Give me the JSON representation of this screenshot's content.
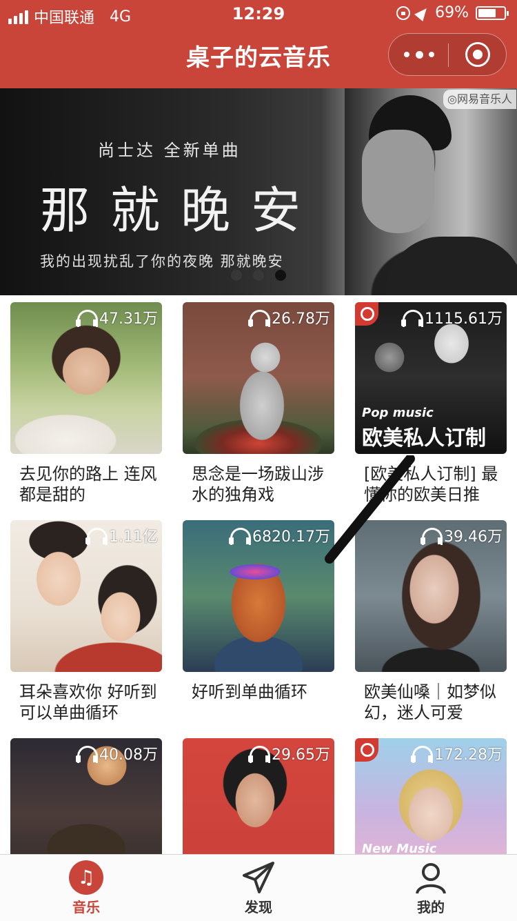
{
  "status_bar": {
    "carrier": "中国联通",
    "network": "4G",
    "time": "12:29",
    "battery": "69%",
    "battery_level": 0.69
  },
  "header": {
    "title": "桌子的云音乐",
    "colors": {
      "brand": "#c9453a"
    }
  },
  "banner": {
    "subtitle": "尚士达 全新单曲",
    "headline": "那就晚安",
    "tagline": "我的出现扰乱了你的夜晚 那就晚安",
    "brand": "网易音乐人",
    "slide_count": 3,
    "active_slide": 3
  },
  "playlists": [
    {
      "play_count": "47.31万",
      "title": "去见你的路上 连风都是甜的",
      "official": false
    },
    {
      "play_count": "26.78万",
      "title": "思念是一场跋山涉水的独角戏",
      "official": false
    },
    {
      "play_count": "1115.61万",
      "title": "[欧美私人订制] 最懂你的欧美日推",
      "official": true,
      "cover_caption_small": "Pop music",
      "cover_caption_big": "欧美私人订制"
    },
    {
      "play_count": "1.11亿",
      "title": "耳朵喜欢你 好听到可以单曲循环",
      "official": false
    },
    {
      "play_count": "6820.17万",
      "title": "好听到单曲循环",
      "official": false
    },
    {
      "play_count": "39.46万",
      "title": "欧美仙嗓｜如梦似幻，迷人可爱",
      "official": false
    },
    {
      "play_count": "40.08万",
      "title": "",
      "official": false
    },
    {
      "play_count": "29.65万",
      "title": "",
      "official": false
    },
    {
      "play_count": "172.28万",
      "title": "",
      "official": true,
      "cover_caption_small": "New Music"
    }
  ],
  "tabbar": {
    "items": [
      {
        "label": "音乐",
        "icon": "music-note-icon",
        "active": true
      },
      {
        "label": "发现",
        "icon": "paper-plane-icon",
        "active": false
      },
      {
        "label": "我的",
        "icon": "user-icon",
        "active": false
      }
    ]
  }
}
